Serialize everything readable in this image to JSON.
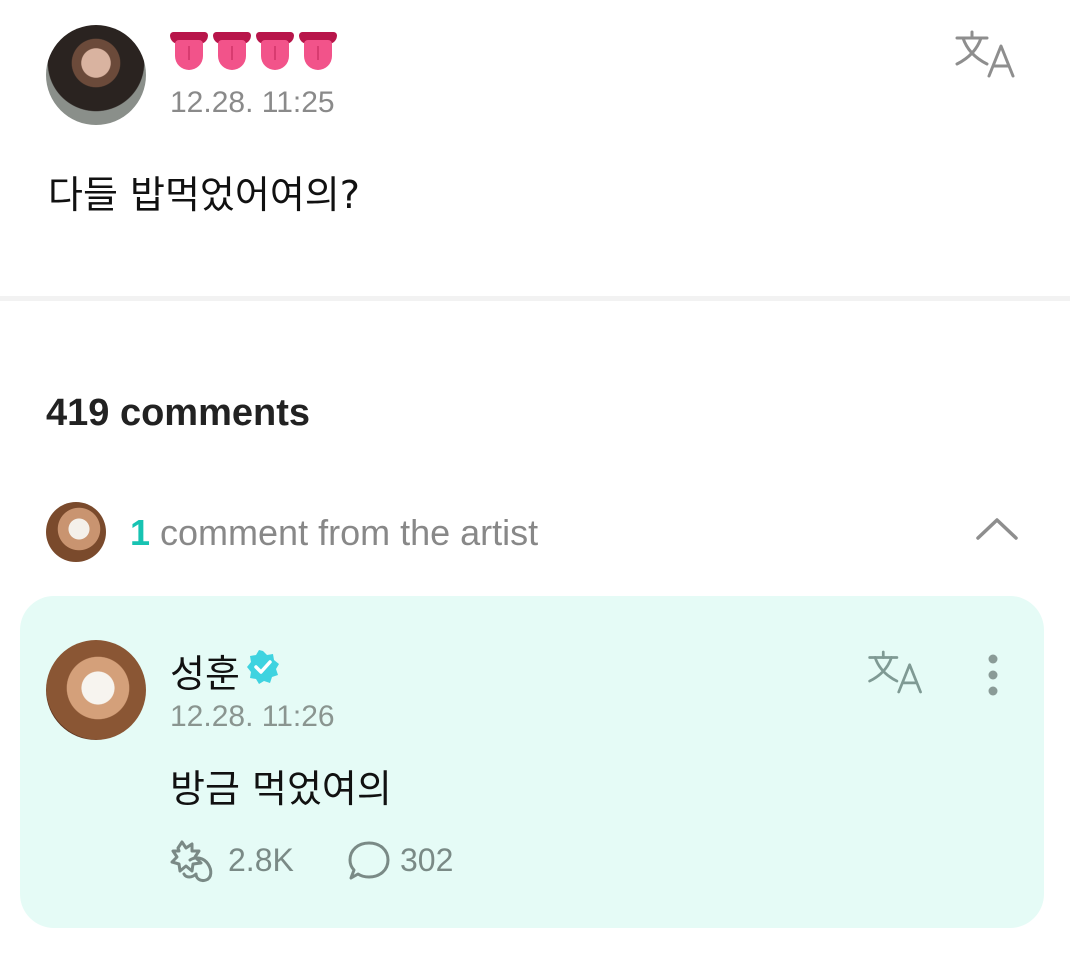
{
  "post": {
    "author_emoji": "👅👅👅👅",
    "time": "12.28. 11:25",
    "body": "다들 밥먹었어여의?",
    "translate_icon": "translate-icon"
  },
  "comments": {
    "count_label": "419 comments",
    "artist_toggle": {
      "count": "1",
      "label": " comment from the artist",
      "icon": "chevron-up-icon"
    }
  },
  "artist_comment": {
    "name": "성훈",
    "verified_icon": "verified-badge-icon",
    "time": "12.28. 11:26",
    "body": "방금 먹었여의",
    "likes": "2.8K",
    "replies": "302",
    "card_color": "#e5fbf6",
    "accent_color": "#17c3b2"
  }
}
